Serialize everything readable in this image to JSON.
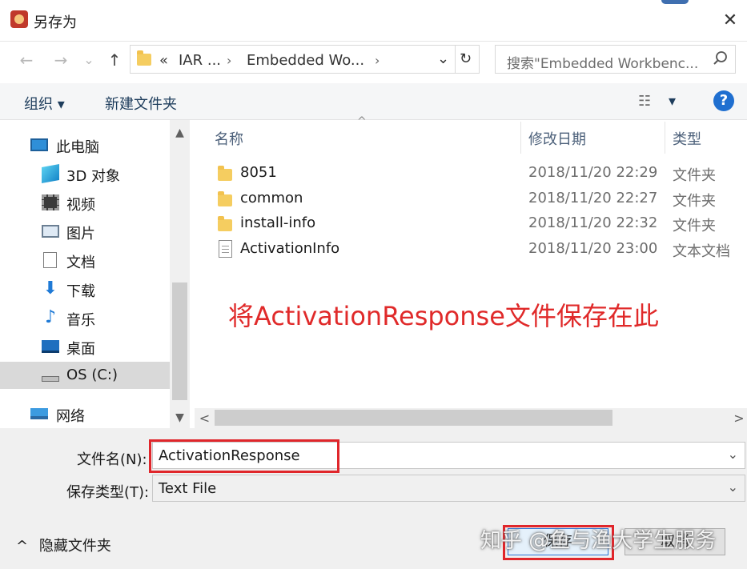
{
  "window": {
    "title": "另存为",
    "close_glyph": "✕"
  },
  "nav": {
    "back": "←",
    "forward": "→",
    "recent": "⌄",
    "up": "↑"
  },
  "address": {
    "overflow": "«",
    "crumbs": [
      "IAR ...",
      "Embedded Wo..."
    ],
    "separator": "›",
    "dropdown": "⌄",
    "refresh": "↻"
  },
  "search": {
    "placeholder": "搜索\"Embedded Workbenc..."
  },
  "toolbar": {
    "organize": "组织 ▾",
    "new_folder": "新建文件夹",
    "view_glyph": "☷",
    "view_dropdown": "▾",
    "help": "?"
  },
  "sidebar": {
    "items": [
      {
        "label": "此电脑",
        "icon": "computer-icon"
      },
      {
        "label": "3D 对象",
        "icon": "cube-3d-icon"
      },
      {
        "label": "视频",
        "icon": "video-icon"
      },
      {
        "label": "图片",
        "icon": "pictures-icon"
      },
      {
        "label": "文档",
        "icon": "documents-icon"
      },
      {
        "label": "下载",
        "icon": "download-icon"
      },
      {
        "label": "音乐",
        "icon": "music-icon"
      },
      {
        "label": "桌面",
        "icon": "desktop-icon"
      },
      {
        "label": "OS (C:)",
        "icon": "drive-icon"
      },
      {
        "label": "网络",
        "icon": "network-icon"
      }
    ],
    "scroll_up": "▲",
    "scroll_down": "▼"
  },
  "columns": {
    "name": "名称",
    "modified": "修改日期",
    "type": "类型",
    "sort_indicator": "^"
  },
  "files": [
    {
      "name": "8051",
      "modified": "2018/11/20 22:29",
      "type": "文件夹",
      "icon": "folder-icon"
    },
    {
      "name": "common",
      "modified": "2018/11/20 22:27",
      "type": "文件夹",
      "icon": "folder-icon"
    },
    {
      "name": "install-info",
      "modified": "2018/11/20 22:32",
      "type": "文件夹",
      "icon": "folder-icon"
    },
    {
      "name": "ActivationInfo",
      "modified": "2018/11/20 23:00",
      "type": "文本文档",
      "icon": "text-file-icon"
    }
  ],
  "annotation": "将ActivationResponse文件保存在此",
  "hscroll": {
    "left": "<",
    "right": ">"
  },
  "form": {
    "filename_label": "文件名(N):",
    "filename_value": "ActivationResponse",
    "filetype_label": "保存类型(T):",
    "filetype_value": "Text File",
    "dropdown": "⌄"
  },
  "footer": {
    "hide_folders": "隐藏文件夹",
    "hide_glyph": "^",
    "save": "保存",
    "cancel": "取消"
  },
  "watermark": "知乎 @鱼与渔大学生服务",
  "colors": {
    "accent": "#1f6fd0",
    "annotation_red": "#e02a2a",
    "folder": "#f5cd60"
  }
}
